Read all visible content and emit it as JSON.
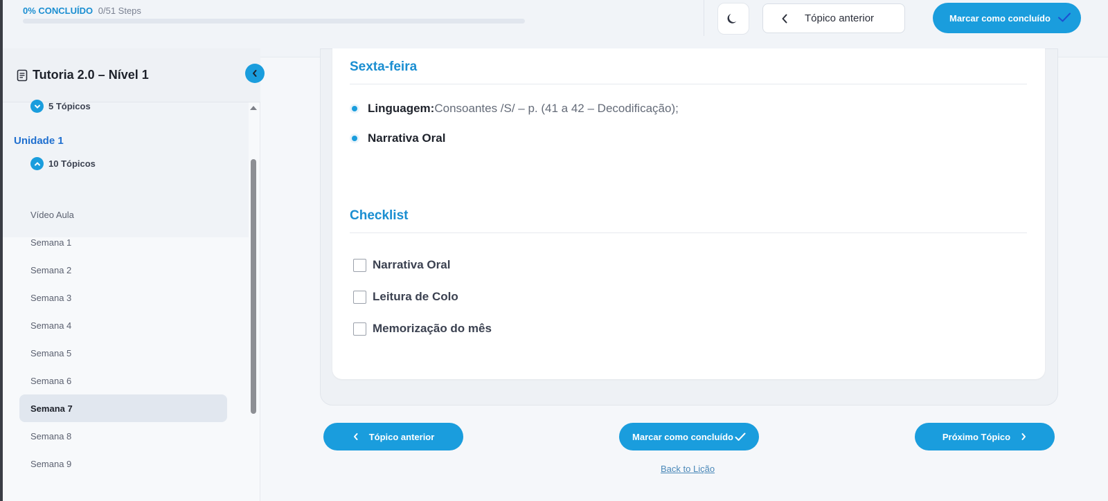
{
  "progress": {
    "percent_label": "0% CONCLUÍDO",
    "steps_label": "0/51 Steps",
    "value": 0
  },
  "topbar": {
    "prev_label": "Tópico anterior",
    "mark_label": "Marcar como concluído"
  },
  "sidebar": {
    "course_title": "Tutoria 2.0 – Nível 1",
    "prev_section_topics": "5 Tópicos",
    "unit_title": "Unidade 1",
    "unit_topics": "10 Tópicos",
    "items": [
      {
        "label": "Vídeo Aula",
        "active": false
      },
      {
        "label": "Semana 1",
        "active": false
      },
      {
        "label": "Semana 2",
        "active": false
      },
      {
        "label": "Semana 3",
        "active": false
      },
      {
        "label": "Semana 4",
        "active": false
      },
      {
        "label": "Semana 5",
        "active": false
      },
      {
        "label": "Semana 6",
        "active": false
      },
      {
        "label": "Semana 7",
        "active": true
      },
      {
        "label": "Semana 8",
        "active": false
      },
      {
        "label": "Semana 9",
        "active": false
      }
    ]
  },
  "content": {
    "day_title": "Sexta-feira",
    "bullets": [
      {
        "bold": "Linguagem:",
        "text": " Consoantes /S/ – p. (41 a 42 – Decodificação);"
      },
      {
        "bold": "Narrativa Oral",
        "text": ""
      }
    ],
    "checklist_title": "Checklist",
    "checklist": [
      "Narrativa Oral",
      "Leitura de Colo",
      "Memorização do mês"
    ]
  },
  "bottom_nav": {
    "prev_label": "Tópico anterior",
    "mark_label": "Marcar como concluído",
    "next_label": "Próximo Tópico",
    "back_label": "Back to Lição"
  },
  "colors": {
    "accent": "#1a9ddd",
    "unit": "#1f6fcf"
  }
}
